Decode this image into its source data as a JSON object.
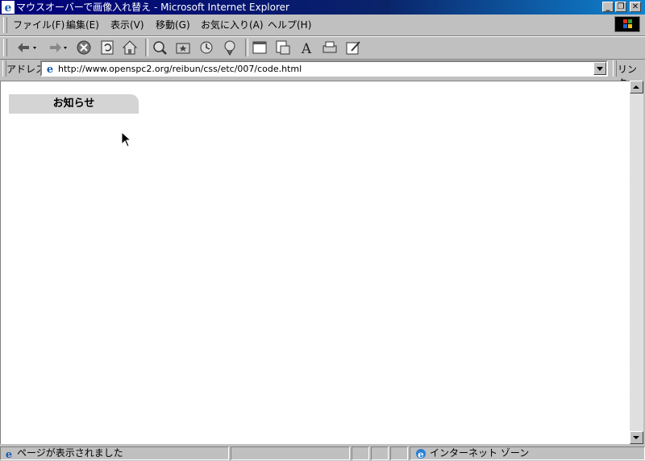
{
  "window": {
    "title": "マウスオーバーで画像入れ替え - Microsoft Internet Explorer",
    "minimize": "_",
    "restore": "❐",
    "close": "✕"
  },
  "menu": {
    "items": [
      "ファイル(F)",
      "編集(E)",
      "表示(V)",
      "移動(G)",
      "お気に入り(A)",
      "ヘルプ(H)"
    ]
  },
  "toolbar": {
    "buttons": [
      "back-icon",
      "forward-icon",
      "stop-icon",
      "refresh-icon",
      "home-icon",
      "search-icon",
      "favorites-icon",
      "history-icon",
      "channels-icon",
      "fullscreen-icon",
      "mail-icon",
      "font-icon",
      "print-icon",
      "edit-icon"
    ]
  },
  "address": {
    "label": "アドレス",
    "url": "http://www.openspc2.org/reibun/css/etc/007/code.html",
    "links_label": "リンク"
  },
  "page": {
    "notice_heading": "お知らせ"
  },
  "status": {
    "message": "ページが表示されました",
    "zone": "インターネット ゾーン"
  },
  "colors": {
    "title_start": "#00007b",
    "title_end": "#1084d0",
    "chrome": "#c0c0c0",
    "notice_bg": "#d4d4d4"
  }
}
